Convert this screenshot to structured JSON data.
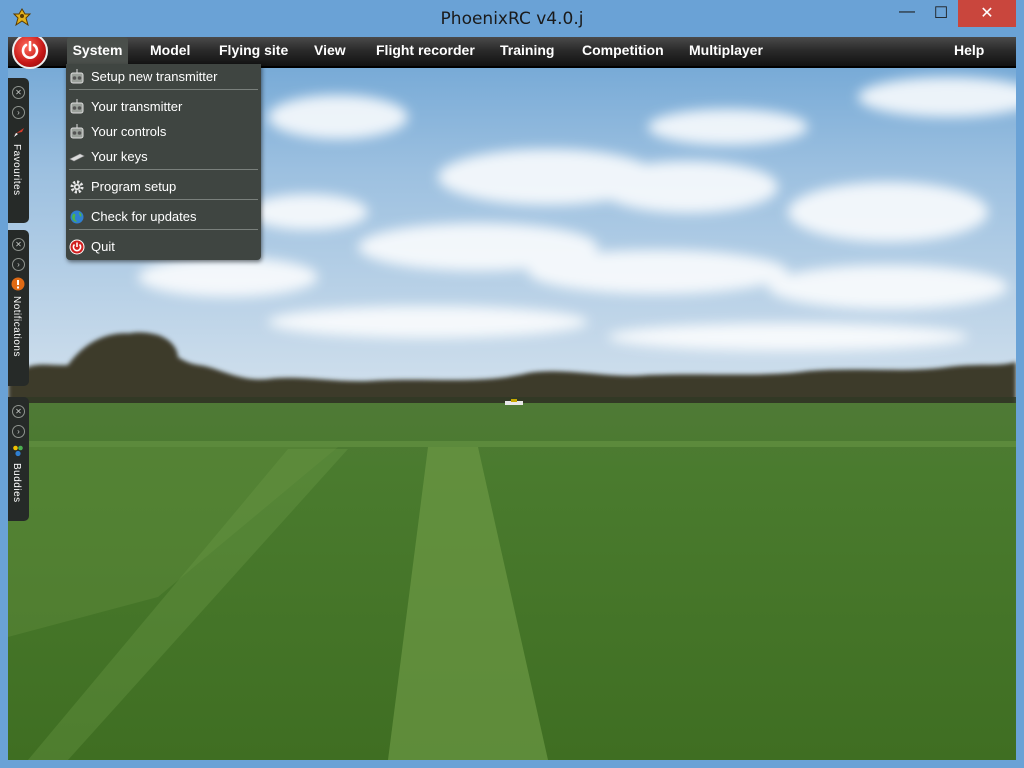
{
  "window": {
    "title": "PhoenixRC v4.0.j",
    "buttons": {
      "minimize": "—",
      "maximize": "☐",
      "close": "✕"
    }
  },
  "menubar": {
    "items": [
      {
        "label": "System",
        "active": true
      },
      {
        "label": "Model"
      },
      {
        "label": "Flying site"
      },
      {
        "label": "View"
      },
      {
        "label": "Flight recorder"
      },
      {
        "label": "Training"
      },
      {
        "label": "Competition"
      },
      {
        "label": "Multiplayer"
      },
      {
        "label": "Help"
      }
    ]
  },
  "system_menu": {
    "items": [
      {
        "label": "Setup new transmitter",
        "icon": "transmitter-icon"
      },
      {
        "label": "Your transmitter",
        "icon": "transmitter-icon"
      },
      {
        "label": "Your controls",
        "icon": "transmitter-icon"
      },
      {
        "label": "Your keys",
        "icon": "keyboard-icon"
      },
      {
        "label": "Program setup",
        "icon": "gear-icon"
      },
      {
        "label": "Check for updates",
        "icon": "globe-icon"
      },
      {
        "label": "Quit",
        "icon": "power-icon"
      }
    ]
  },
  "side_panels": [
    {
      "label": "Favourites",
      "icon": "airplane-icon"
    },
    {
      "label": "Notifications",
      "icon": "alert-icon"
    },
    {
      "label": "Buddies",
      "icon": "buddies-icon"
    }
  ],
  "colors": {
    "titlebar": "#6aa2d6",
    "close_button": "#c9463d",
    "menu_background": "#3f4541",
    "power_button": "#c51616"
  }
}
